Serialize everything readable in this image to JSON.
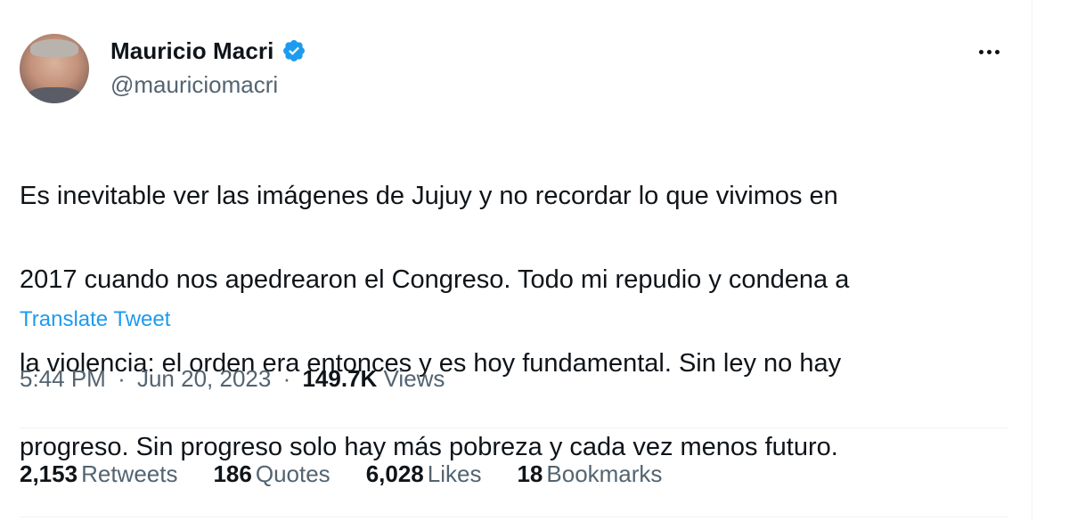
{
  "author": {
    "display_name": "Mauricio Macri",
    "handle": "@mauriciomacri",
    "verified": true
  },
  "tweet": {
    "text_lines": [
      "Es inevitable ver las imágenes de Jujuy y no recordar lo que vivimos en",
      "2017 cuando nos apedrearon el Congreso. Todo mi repudio y condena a",
      "la violencia: el orden era entonces y es hoy fundamental. Sin ley no hay",
      "progreso. Sin progreso solo hay más pobreza y cada vez menos futuro."
    ],
    "translate_label": "Translate Tweet",
    "time": "5:44 PM",
    "date": "Jun 20, 2023",
    "separator": "·",
    "views_count": "149.7K",
    "views_label": "Views"
  },
  "stats": {
    "retweets": {
      "count": "2,153",
      "label": "Retweets"
    },
    "quotes": {
      "count": "186",
      "label": "Quotes"
    },
    "likes": {
      "count": "6,028",
      "label": "Likes"
    },
    "bookmarks": {
      "count": "18",
      "label": "Bookmarks"
    }
  },
  "colors": {
    "accent": "#1d9bf0",
    "text_primary": "#0f1419",
    "text_secondary": "#536471",
    "border": "#eff3f4"
  },
  "icons": {
    "verified": "verified-badge-icon",
    "more": "more-horizontal-icon"
  }
}
